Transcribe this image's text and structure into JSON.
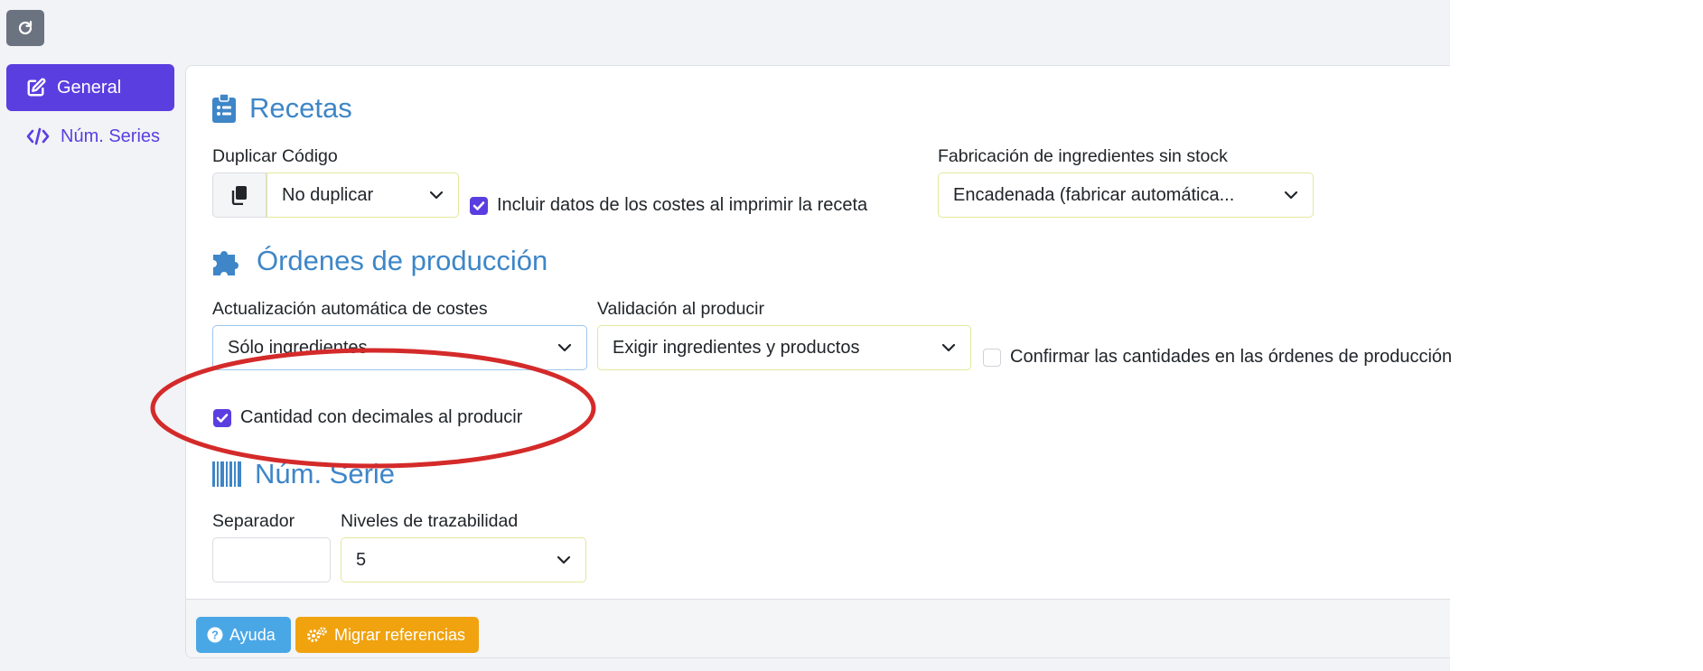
{
  "sidebar": {
    "refresh_icon": "refresh-icon",
    "items": [
      {
        "label": "General",
        "icon": "edit-icon",
        "active": true
      },
      {
        "label": "Núm. Series",
        "icon": "code-icon",
        "active": false
      }
    ]
  },
  "recetas": {
    "title": "Recetas",
    "icon": "clipboard-list-icon",
    "duplicar_label": "Duplicar Código",
    "duplicar_value": "No duplicar",
    "incluir_costes_label": "Incluir datos de los costes al imprimir la receta",
    "incluir_costes_checked": true,
    "fabricacion_label": "Fabricación de ingredientes sin stock",
    "fabricacion_value": "Encadenada (fabricar automática..."
  },
  "ordenes": {
    "title": "Órdenes de producción",
    "icon": "puzzle-icon",
    "actualizacion_label": "Actualización automática de costes",
    "actualizacion_value": "Sólo ingredientes",
    "validacion_label": "Validación al producir",
    "validacion_value": "Exigir ingredientes y productos",
    "confirmar_label": "Confirmar las cantidades en las órdenes de producción",
    "confirmar_checked": false,
    "decimales_label": "Cantidad con decimales al producir",
    "decimales_checked": true
  },
  "num_serie": {
    "title": "Núm. Serie",
    "icon": "barcode-icon",
    "separador_label": "Separador",
    "separador_value": "",
    "niveles_label": "Niveles de trazabilidad",
    "niveles_value": "5"
  },
  "footer": {
    "help_label": "Ayuda",
    "migrate_label": "Migrar referencias"
  },
  "colors": {
    "accent": "#5b3ee0",
    "section_title": "#3e86c7",
    "help_button": "#4aa7e6",
    "migrate_button": "#f0a20f",
    "annotation": "#d42a2a"
  }
}
